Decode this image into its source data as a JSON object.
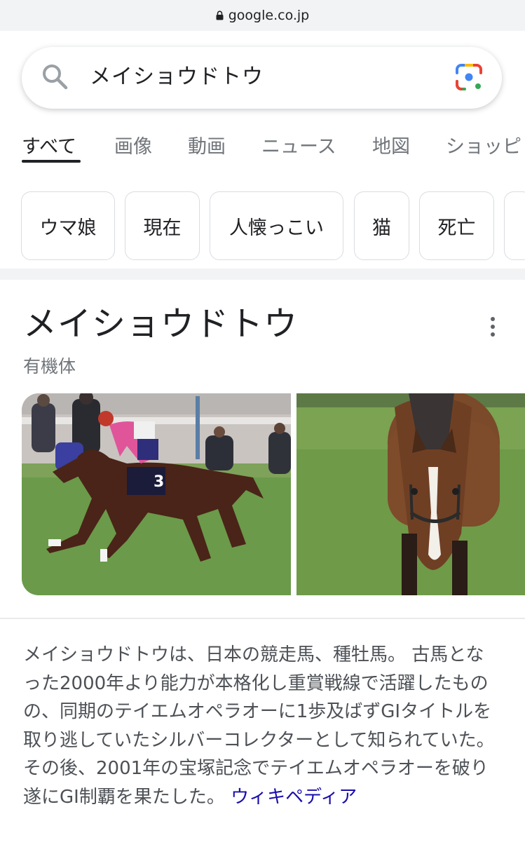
{
  "browser": {
    "url": "google.co.jp"
  },
  "search": {
    "query": "メイショウドトウ"
  },
  "tabs": [
    "すべて",
    "画像",
    "動画",
    "ニュース",
    "地図",
    "ショッピ"
  ],
  "chips": [
    "ウマ娘",
    "現在",
    "人懐っこい",
    "猫",
    "死亡"
  ],
  "knowledge_panel": {
    "title": "メイショウドトウ",
    "subtitle": "有機体",
    "description": "メイショウドトウは、日本の競走馬、種牡馬。 古馬となった2000年より能力が本格化し重賞戦線で活躍したものの、同期のテイエムオペラオーに1歩及ばずGIタイトルを取り逃していたシルバーコレクターとして知られていた。その後、2001年の宝塚記念でテイエムオペラオーを破り遂にGI制覇を果たした。",
    "source_link": "ウィキペディア"
  },
  "colors": {
    "link": "#1a0dab",
    "grass": "#6b9a4a",
    "horse": "#4a2418"
  }
}
